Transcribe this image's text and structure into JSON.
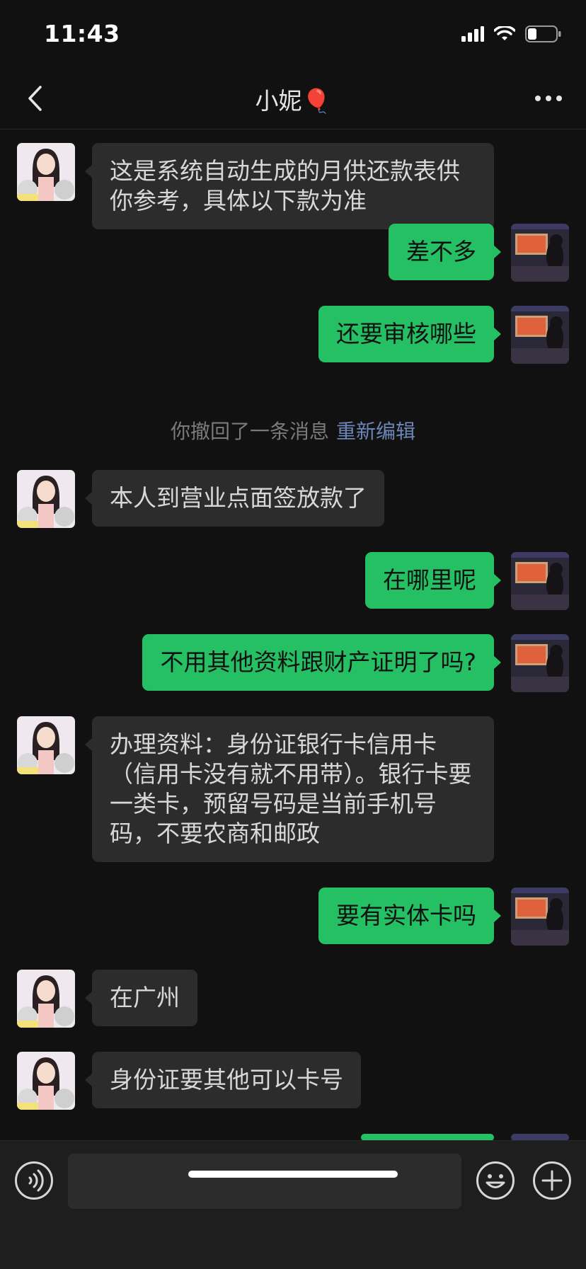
{
  "status": {
    "time": "11:43"
  },
  "header": {
    "title": "小妮🎈"
  },
  "messages": [
    {
      "side": "in",
      "text": "这是系统自动生成的月供还款表供你参考，具体以下款为准"
    },
    {
      "side": "out",
      "text": "差不多"
    },
    {
      "side": "out",
      "text": "还要审核哪些"
    },
    {
      "side": "in",
      "text": "本人到营业点面签放款了"
    },
    {
      "side": "out",
      "text": "在哪里呢"
    },
    {
      "side": "out",
      "text": "不用其他资料跟财产证明了吗?"
    },
    {
      "side": "in",
      "text": "办理资料：身份证银行卡信用卡（信用卡没有就不用带）。银行卡要一类卡，预留号码是当前手机号码，不要农商和邮政"
    },
    {
      "side": "out",
      "text": "要有实体卡吗"
    },
    {
      "side": "in",
      "text": "在广州"
    },
    {
      "side": "in",
      "text": "身份证要其他可以卡号"
    }
  ],
  "system_notice": {
    "text": "你撤回了一条消息",
    "action": "重新编辑"
  },
  "input": {
    "value": "",
    "placeholder": ""
  },
  "icons": {
    "back": "chevron-left-icon",
    "more": "more-dots-icon",
    "voice": "voice-icon",
    "emoji": "emoji-icon",
    "plus": "plus-icon"
  },
  "colors": {
    "outgoing_bubble": "#24c063",
    "incoming_bubble": "#2c2c2c",
    "background": "#111111"
  }
}
